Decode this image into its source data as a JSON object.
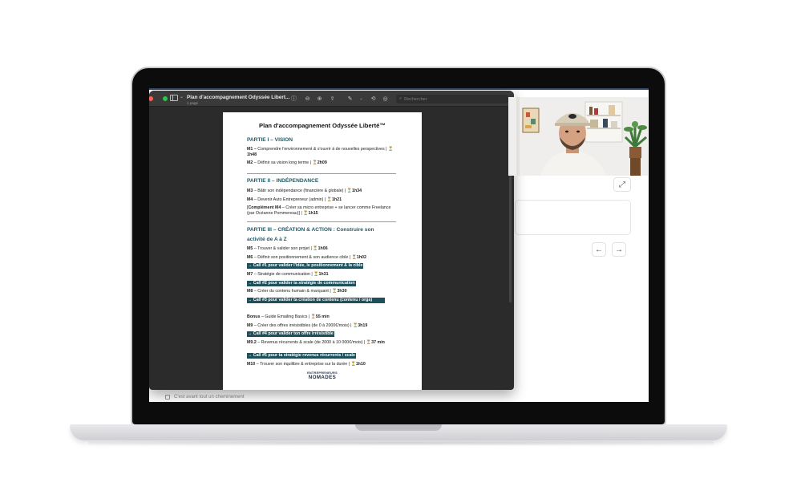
{
  "preview": {
    "title": "Plan d'accompagnement Odyssée Libert...",
    "subtitle": "1 page",
    "search_placeholder": "Rechercher"
  },
  "pdf": {
    "title": "Plan d'accompagnement Odyssée Liberté™",
    "part1": {
      "title": "PARTIE I – VISION"
    },
    "m1": {
      "code": "M1 –",
      "text": " Comprendre l'environnement & s'ouvrir à de nouvelles perspectives | ",
      "time": "1h48"
    },
    "m2": {
      "code": "M2",
      "text": " – Définir sa vision long terme | ",
      "time": "2h09"
    },
    "part2": {
      "title": "PARTIE II – INDÉPENDANCE"
    },
    "m3": {
      "code": "M3",
      "text": " – Bâtir son indépendance (financière & globale) | ",
      "time": "1h34"
    },
    "m4": {
      "code": "M4",
      "text": " – Devenir Auto Entrepreneur (admin) | ",
      "time": "1h21"
    },
    "m4c": {
      "code": "Complément M4",
      "text": " – Créer sa micro entreprise + se lancer comme Freelance (par Océanne Pommereau)] | ",
      "time": "1h15"
    },
    "part3": {
      "title_line1": "PARTIE III – CRÉATION & ACTION : Construire son",
      "title_line2": "activité de A à Z"
    },
    "m5": {
      "code": "M5",
      "text": " – Trouver & valider son projet | ",
      "time": "1h06"
    },
    "m6": {
      "code": "M6",
      "text": " – Définir son positionnement & son audience cible | ",
      "time": "1h02"
    },
    "call1": "→ Call #1 pour valider l'idée, le positionnement & la cible",
    "m7": {
      "code": "M7",
      "text": " – Stratégie de communication | ",
      "time": "1h31"
    },
    "call2": "→ Call #2 pour valider ta stratégie de communication",
    "m8": {
      "code": "M8",
      "text": " – Créer du contenu humain & marquant | ",
      "time": "3h30"
    },
    "call3": "→ Call #3 pour valider ta création de contenu (contenu / orga)",
    "bonus": {
      "code": "Bonus",
      "text": " – Guide Emailing Basics | ",
      "time": "55 min"
    },
    "m9": {
      "code": "M9",
      "text": " – Créer des offres irrésistibles (de 0 à 2000€/mois) | ",
      "time": "3h19"
    },
    "call4": "→ Call #4 pour valider ton offre irrésistible",
    "m92": {
      "code": "M9.2",
      "text": " – Revenus récurrents & scale (de 2000 à 10 000€/mois) | ",
      "time": "37 min"
    },
    "call5": "→ Call #5 pour ta stratégie revenus récurrents / scale",
    "m10": {
      "code": "M10",
      "text": " – Trouver son équilibre & entreprise sur la durée | ",
      "time": "1h10"
    },
    "logo_top": "ENTREPRENEURS",
    "logo_bottom": "NOMADES"
  },
  "background_app": {
    "footer_note": "C'est avant tout un cheminement"
  },
  "icons": {
    "hourglass": "⏳",
    "arrow_left": "←",
    "arrow_right": "→",
    "expand": "⤢"
  },
  "colors": {
    "section_heading": "#1e5a66",
    "call_highlight": "#1e4f5a",
    "window_toolbar": "#3a3a3a",
    "close_dot": "#ff5f57",
    "max_dot": "#28c840"
  }
}
